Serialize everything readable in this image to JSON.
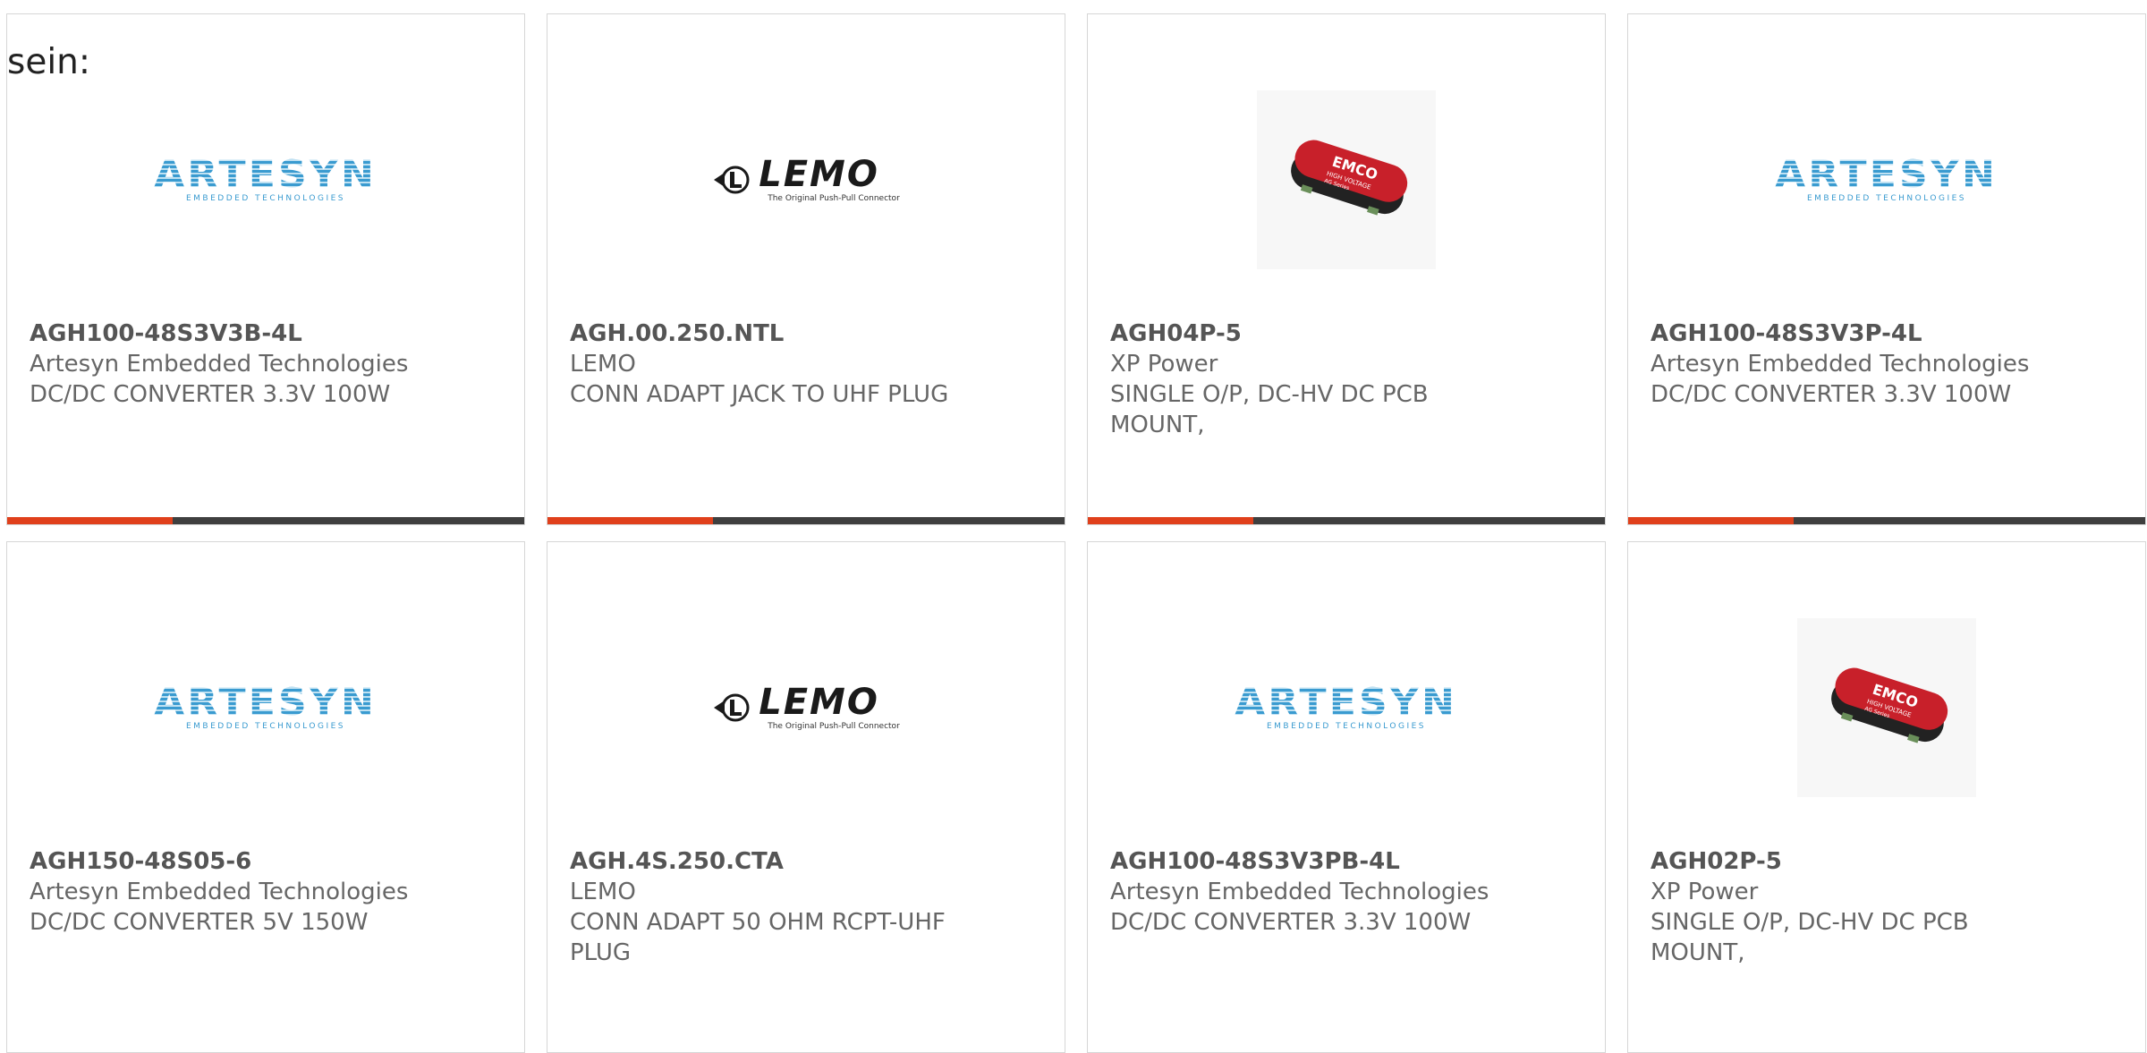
{
  "intro_text": "sein:",
  "logos": {
    "artesyn_word": "ARTESYN",
    "artesyn_sub": "EMBEDDED TECHNOLOGIES",
    "lemo_word": "LEMO",
    "lemo_sub": "The Original Push-Pull Connector",
    "emco_word": "EMCO",
    "emco_sub": "HIGH VOLTAGE",
    "emco_sub2": "AG Series"
  },
  "colors": {
    "accent": "#e0401b",
    "bar_dark": "#3f3f3f",
    "artesyn_blue": "#3a9bd0",
    "emco_red": "#c8202a",
    "text_gray": "#666666"
  },
  "products": [
    {
      "part": "AGH100-48S3V3B-4L",
      "maker": "Artesyn Embedded Technologies",
      "desc": "DC/DC CONVERTER 3.3V 100W",
      "logo": "artesyn"
    },
    {
      "part": "AGH.00.250.NTL",
      "maker": "LEMO",
      "desc": "CONN ADAPT JACK TO UHF PLUG",
      "logo": "lemo"
    },
    {
      "part": "AGH04P-5",
      "maker": "XP Power",
      "desc": "SINGLE O/P, DC-HV DC PCB MOUNT,",
      "logo": "emco"
    },
    {
      "part": "AGH100-48S3V3P-4L",
      "maker": "Artesyn Embedded Technologies",
      "desc": "DC/DC CONVERTER 3.3V 100W",
      "logo": "artesyn"
    },
    {
      "part": "AGH150-48S05-6",
      "maker": "Artesyn Embedded Technologies",
      "desc": "DC/DC CONVERTER 5V 150W",
      "logo": "artesyn"
    },
    {
      "part": "AGH.4S.250.CTA",
      "maker": "LEMO",
      "desc": "CONN ADAPT 50 OHM RCPT-UHF PLUG",
      "logo": "lemo"
    },
    {
      "part": "AGH100-48S3V3PB-4L",
      "maker": "Artesyn Embedded Technologies",
      "desc": "DC/DC CONVERTER 3.3V 100W",
      "logo": "artesyn"
    },
    {
      "part": "AGH02P-5",
      "maker": "XP Power",
      "desc": "SINGLE O/P, DC-HV DC PCB MOUNT,",
      "logo": "emco"
    }
  ]
}
